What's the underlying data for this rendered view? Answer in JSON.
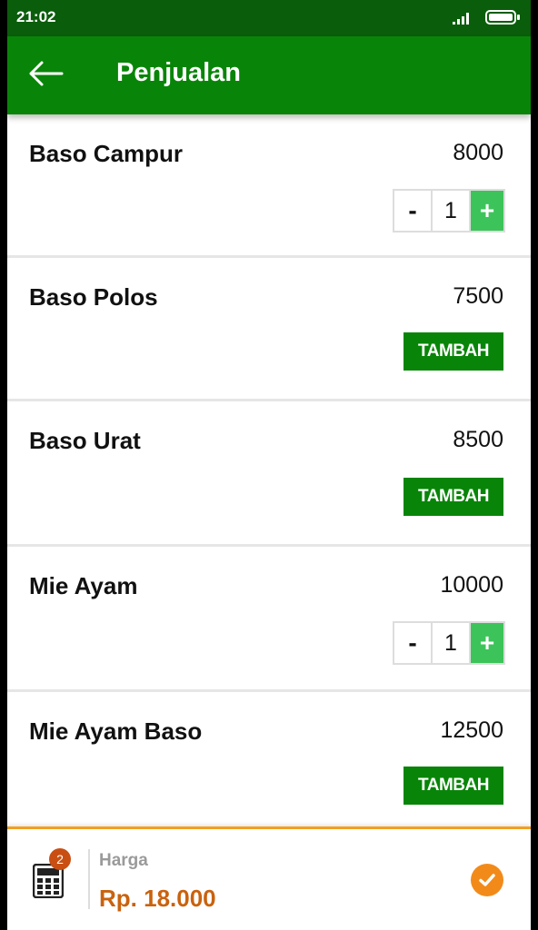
{
  "status_bar": {
    "time": "21:02",
    "signal_icon": "signal-icon",
    "battery_icon": "battery-icon"
  },
  "app_bar": {
    "title": "Penjualan",
    "back_icon": "arrow-left-icon"
  },
  "items": [
    {
      "name": "Baso Campur",
      "price": "8000",
      "in_cart": true,
      "qty": "1"
    },
    {
      "name": "Baso Polos",
      "price": "7500",
      "in_cart": false,
      "add_label": "TAMBAH"
    },
    {
      "name": "Baso Urat",
      "price": "8500",
      "in_cart": false,
      "add_label": "TAMBAH"
    },
    {
      "name": "Mie Ayam",
      "price": "10000",
      "in_cart": true,
      "qty": "1"
    },
    {
      "name": "Mie Ayam Baso",
      "price": "12500",
      "in_cart": false,
      "add_label": "TAMBAH"
    }
  ],
  "stepper": {
    "minus": "-",
    "plus": "+"
  },
  "footer": {
    "cart_count": "2",
    "harga_label": "Harga",
    "harga_value": "Rp. 18.000",
    "calculator_icon": "calculator-icon",
    "confirm_icon": "check-circle-icon"
  },
  "colors": {
    "appbar": "#088508",
    "statusbar": "#0a5d0a",
    "plus": "#3cc45a",
    "accent": "#f28a1a",
    "price": "#c9620e"
  }
}
